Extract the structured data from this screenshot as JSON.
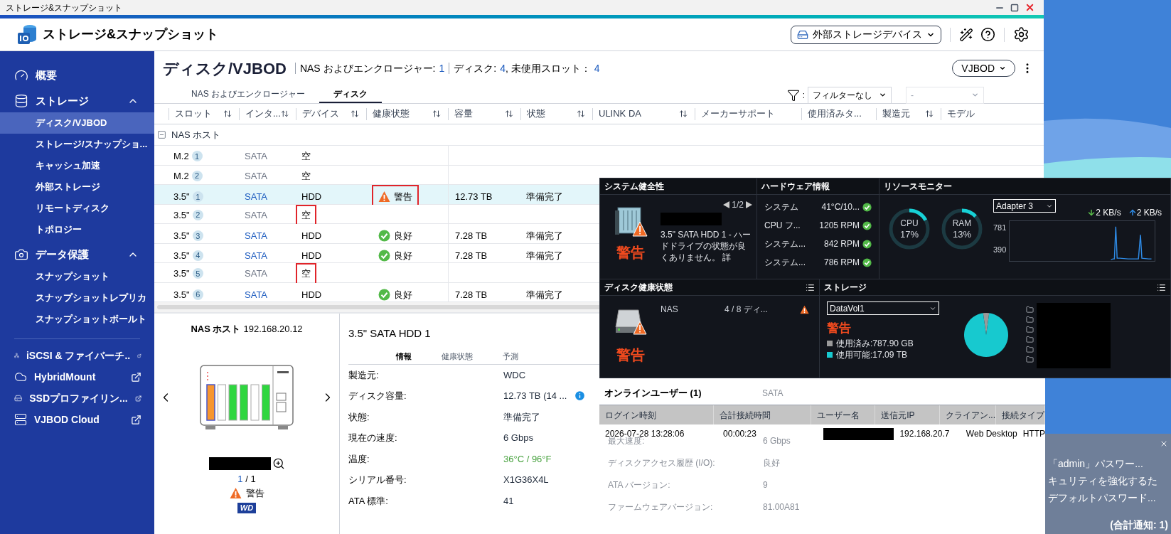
{
  "window": {
    "title": "ストレージ&スナップショット"
  },
  "app": {
    "title": "ストレージ&スナップショット",
    "device_menu": "外部ストレージデバイス"
  },
  "sidebar": {
    "sections": [
      {
        "label": "概要"
      },
      {
        "label": "ストレージ",
        "expanded": true,
        "children": [
          {
            "label": "ディスク/VJBOD",
            "selected": true
          },
          {
            "label": "ストレージ/スナップショ...",
            "selected": false
          },
          {
            "label": "キャッシュ加速",
            "selected": false
          },
          {
            "label": "外部ストレージ",
            "selected": false
          },
          {
            "label": "リモートディスク",
            "selected": false
          },
          {
            "label": "トポロジー",
            "selected": false
          }
        ]
      },
      {
        "label": "データ保護",
        "expanded": true,
        "children": [
          {
            "label": "スナップショット",
            "selected": false
          },
          {
            "label": "スナップショットレプリカ",
            "selected": false
          },
          {
            "label": "スナップショットボールト",
            "selected": false
          }
        ]
      }
    ],
    "links": [
      {
        "label": "iSCSI & ファイバーチ.."
      },
      {
        "label": "HybridMount"
      },
      {
        "label": "SSDプロファイリン..."
      },
      {
        "label": "VJBOD Cloud"
      }
    ]
  },
  "page": {
    "title": "ディスク/VJBOD",
    "summary": [
      {
        "items": [
          {
            "label": "NAS およびエンクロージャー:",
            "value": "1"
          }
        ]
      },
      {
        "items": [
          {
            "label": "ディスク:",
            "value": "4"
          },
          {
            "label": ", 未使用スロット：",
            "value": "4"
          }
        ]
      }
    ],
    "view_menu": "VJBOD"
  },
  "tabs": [
    {
      "label": "NAS およびエンクロージャー",
      "selected": false
    },
    {
      "label": "ディスク",
      "selected": true
    }
  ],
  "filter": {
    "label": ":",
    "value": "フィルターなし",
    "secondary": {
      "value": "-",
      "disabled": true
    }
  },
  "table": {
    "columns": [
      {
        "label": "スロット",
        "sortable": true
      },
      {
        "label": "インタ...",
        "sortable": true
      },
      {
        "label": "デバイス",
        "sortable": true
      },
      {
        "label": "健康状態",
        "sortable": true
      },
      {
        "label": "容量",
        "sortable": true
      },
      {
        "label": "状態",
        "sortable": true
      },
      {
        "label": "ULINK DA",
        "sortable": true
      },
      {
        "label": "メーカーサポート",
        "sortable": false
      },
      {
        "label": "使用済みタ...",
        "sortable": false
      },
      {
        "label": "製造元",
        "sortable": true
      },
      {
        "label": "モデル",
        "sortable": false
      }
    ],
    "groups": [
      {
        "label": "NAS ホスト",
        "expanded": true,
        "rows": [
          {
            "kind": "empty",
            "selected": false,
            "slot": "M.2",
            "slot_number": "1",
            "interface": "SATA",
            "device": {
              "text": "空",
              "marked": false
            }
          },
          {
            "kind": "empty",
            "selected": false,
            "slot": "M.2",
            "slot_number": "2",
            "interface": "SATA",
            "device": {
              "text": "空",
              "marked": false
            }
          },
          {
            "kind": "disk",
            "selected": true,
            "slot": "3.5\"",
            "slot_number": "1",
            "interface": "SATA",
            "device": {
              "text": "HDD",
              "marked": false
            },
            "health": {
              "kind": "warning",
              "text": "警告",
              "marked": true
            },
            "capacity": "12.73 TB",
            "state": "準備完了"
          },
          {
            "kind": "empty",
            "selected": false,
            "slot": "3.5\"",
            "slot_number": "2",
            "interface": "SATA",
            "device": {
              "text": "空",
              "marked": true
            }
          },
          {
            "kind": "disk",
            "selected": false,
            "slot": "3.5\"",
            "slot_number": "3",
            "interface": "SATA",
            "device": {
              "text": "HDD",
              "marked": false
            },
            "health": {
              "kind": "good",
              "text": "良好",
              "marked": false
            },
            "capacity": "7.28 TB",
            "state": "準備完了"
          },
          {
            "kind": "disk",
            "selected": false,
            "slot": "3.5\"",
            "slot_number": "4",
            "interface": "SATA",
            "device": {
              "text": "HDD",
              "marked": false
            },
            "health": {
              "kind": "good",
              "text": "良好",
              "marked": false
            },
            "capacity": "7.28 TB",
            "state": "準備完了"
          },
          {
            "kind": "empty",
            "selected": false,
            "slot": "3.5\"",
            "slot_number": "5",
            "interface": "SATA",
            "device": {
              "text": "空",
              "marked": true
            }
          },
          {
            "kind": "disk",
            "selected": false,
            "slot": "3.5\"",
            "slot_number": "6",
            "interface": "SATA",
            "device": {
              "text": "HDD",
              "marked": false
            },
            "health": {
              "kind": "good",
              "text": "良好",
              "marked": false
            },
            "capacity": "7.28 TB",
            "state": "準備完了"
          }
        ]
      }
    ]
  },
  "detail": {
    "host": {
      "label": "NAS ホスト",
      "ip": "192.168.20.12"
    },
    "bays": [
      {
        "color": "#f7962f",
        "selected": true
      },
      {
        "color": "#ffffff",
        "selected": false
      },
      {
        "color": "#2fd63f",
        "selected": false
      },
      {
        "color": "#2fd63f",
        "selected": false
      },
      {
        "color": "#ffffff",
        "selected": false
      },
      {
        "color": "#2fd63f",
        "selected": false
      }
    ],
    "pager": {
      "current": "1",
      "total": "/ 1"
    },
    "status": {
      "kind": "warning",
      "text": "警告"
    },
    "brand": "WD",
    "disk_title": "3.5\" SATA HDD 1",
    "tabs": [
      {
        "label": "情報",
        "selected": true
      },
      {
        "label": "健康状態",
        "selected": false
      },
      {
        "label": "予測",
        "selected": false
      }
    ],
    "fields": [
      {
        "label": "製造元:",
        "value": "WDC",
        "kind": "plain",
        "info": false
      },
      {
        "label": "ディスク容量:",
        "value": "12.73 TB (14 ...",
        "kind": "plain",
        "info": true
      },
      {
        "label": "状態:",
        "value": "準備完了",
        "kind": "plain",
        "info": false
      },
      {
        "label": "現在の速度:",
        "value": "6 Gbps",
        "kind": "plain",
        "info": false
      },
      {
        "label": "温度:",
        "value": "36°C / 96°F",
        "kind": "good",
        "info": false
      },
      {
        "label": "シリアル番号:",
        "value": "X1G36X4L",
        "kind": "plain",
        "info": false
      },
      {
        "label": "ATA 標準:",
        "value": "41",
        "kind": "plain",
        "info": false
      }
    ]
  },
  "dashboard": {
    "system_health": {
      "title": "システム健全性",
      "status": "警告",
      "pager": "1/2",
      "message": "3.5\" SATA HDD 1 - ハードドライブの状態が良くありません。 詳"
    },
    "hardware": {
      "title": "ハードウェア情報",
      "rows": [
        {
          "name": "システム",
          "value": "41°C/10...",
          "ok": true
        },
        {
          "name": "CPU フ...",
          "value": "1205 RPM",
          "ok": true
        },
        {
          "name": "システム...",
          "value": "842 RPM",
          "ok": true
        },
        {
          "name": "システム...",
          "value": "786 RPM",
          "ok": true
        }
      ]
    },
    "resources": {
      "title": "リソースモニター",
      "meters": [
        {
          "name": "CPU",
          "reading": "17%",
          "level": 0.17
        },
        {
          "name": "RAM",
          "reading": "13%",
          "level": 0.13
        }
      ],
      "adapter": "Adapter 3",
      "download": "2 KB/s",
      "upload": "2 KB/s",
      "axis": [
        "781",
        "390"
      ]
    },
    "disk_health": {
      "title": "ディスク健康状態",
      "status": "警告",
      "rows": [
        {
          "name": "NAS",
          "value": "4 / 8 ディ...",
          "warning": true
        }
      ]
    },
    "storage": {
      "title": "ストレージ",
      "volume": "DataVol1",
      "status": "警告",
      "legend": [
        {
          "value": ":787.90 GB",
          "color": "#9a9a9a"
        },
        {
          "value": ":17.09 TB",
          "color": "#17c9cf"
        }
      ],
      "chart_data": {
        "type": "pie",
        "categories": [
          "使用済み",
          "使用可能"
        ],
        "values": [
          4.41,
          95.59
        ]
      }
    }
  },
  "online_users": {
    "title": "オンラインユーザー (1)",
    "columns": [
      "ログイン時刻",
      "合計接続時間",
      "ユーザー名",
      "送信元IP",
      "クライアン...",
      "接続タイプ"
    ],
    "rows": [
      [
        {
          "kind": "text",
          "text": "2026-07-28 13:28:06"
        },
        {
          "kind": "text",
          "text": "00:00:23"
        },
        {
          "kind": "redacted"
        },
        {
          "kind": "text",
          "text": "192.168.20.7"
        },
        {
          "kind": "text",
          "text": "Web Desktop"
        },
        {
          "kind": "text",
          "text": "HTTP"
        }
      ]
    ]
  },
  "background_detail": {
    "top": "SATA",
    "rows": [
      {
        "label": "最大速度:",
        "value": "6 Gbps"
      },
      {
        "label": "ディスクアクセス履歴 (I/O):",
        "value": "良好"
      },
      {
        "label": "ATA バージョン:",
        "value": "9"
      },
      {
        "label": "ファームウェアバージョン:",
        "value": "81.00A81"
      }
    ]
  },
  "notification": {
    "lines": [
      "「admin」パスワー...",
      "キュリティを強化するた",
      "デフォルトパスワード..."
    ],
    "total": "(合計通知: 1)"
  }
}
